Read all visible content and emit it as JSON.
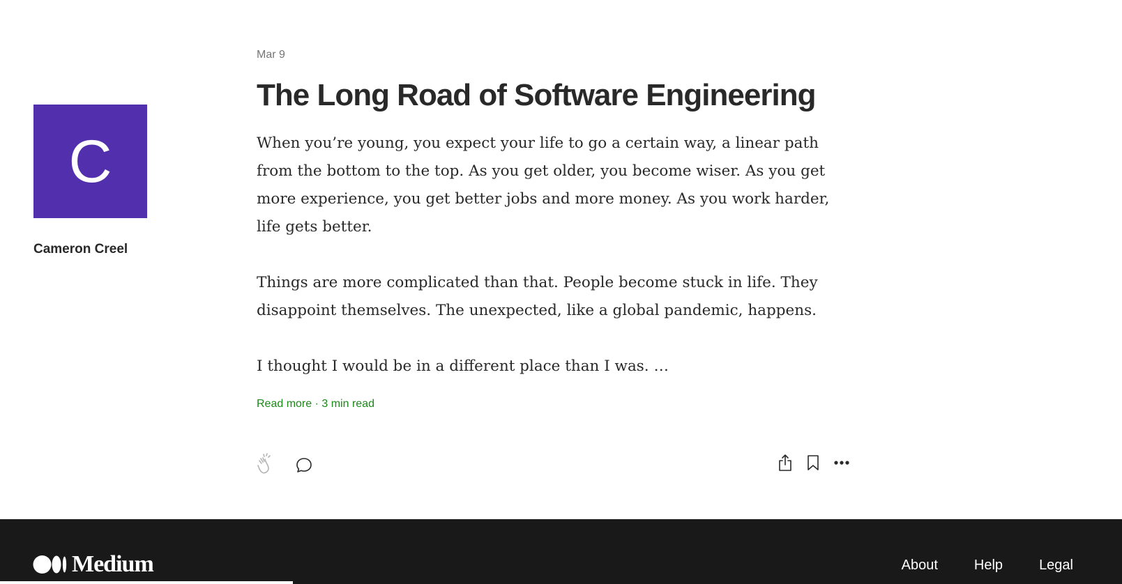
{
  "author": {
    "avatar_letter": "C",
    "avatar_color": "#5230ad",
    "name": "Cameron Creel"
  },
  "article": {
    "date": "Mar 9",
    "title": "The Long Road of Software Engineering",
    "paragraphs": [
      "When you’re young, you expect your life to go a certain way, a linear path from the bottom to the top. As you get older, you become wiser. As you get more experience, you get better jobs and more money. As you work harder, life gets better.",
      "Things are more complicated than that. People become stuck in life. They disappoint themselves. The unexpected, like a global pandemic, happens.",
      "I thought I would be in a different place than I was. …"
    ],
    "read_more": "Read more",
    "separator": " · ",
    "read_time": "3 min read",
    "accent_color": "#1a8917"
  },
  "actions": {
    "icons": [
      "clap-icon",
      "comment-icon",
      "share-icon",
      "bookmark-icon",
      "more-icon"
    ]
  },
  "footer": {
    "logo_text": "Medium",
    "links": [
      "About",
      "Help",
      "Legal"
    ],
    "background": "#191919"
  }
}
